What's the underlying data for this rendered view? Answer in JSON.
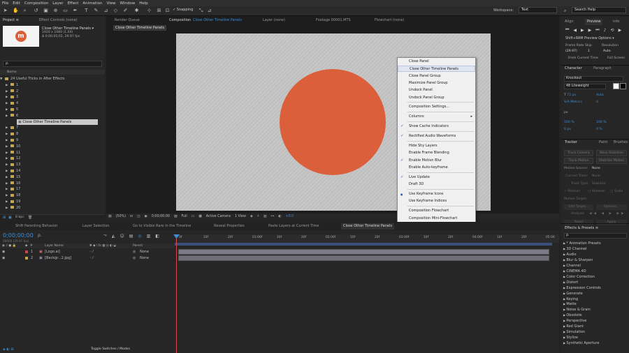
{
  "menu": [
    "File",
    "Edit",
    "Composition",
    "Layer",
    "Effect",
    "Animation",
    "View",
    "Window",
    "Help"
  ],
  "toolbar": {
    "snapping": "Snapping",
    "workspace_label": "Workspace:",
    "workspace_value": "Text",
    "search_help": "Search Help"
  },
  "project": {
    "tabs": [
      "Project ≡",
      "Effect Controls (none)"
    ],
    "selected_name": "Close Other Timeline Panels ▾",
    "selected_info1": "1920 x 1080 (1.00)",
    "selected_info2": "Δ 0;00;05;01, 29.97 fps",
    "search_placeholder": "ρ.",
    "col_name": "Name",
    "root": "24 Useful Tricks in After Effects",
    "folders": [
      "1",
      "2",
      "3",
      "4",
      "5",
      "6",
      "Close Other Timeline Panels",
      "7",
      "8",
      "9",
      "10",
      "11",
      "12",
      "13",
      "14",
      "15",
      "16",
      "17",
      "18",
      "19",
      "20"
    ],
    "bpc": "8 bpc"
  },
  "comp": {
    "tabs": [
      "Render Queue",
      "Composition",
      "Close Other Timeline Panels",
      "Layer (none)",
      "Footage 00001.MTS",
      "Flowchart (none)"
    ],
    "subtab": "Close Other Timeline Panels",
    "footer": {
      "zoom": "(50%)",
      "time": "0;00;00;00",
      "res": "Full",
      "camera": "Active Camera",
      "view": "1 View",
      "exposure": "+0.0"
    }
  },
  "context_menu": [
    {
      "label": "Close Panel",
      "checked": false
    },
    {
      "label": "Close Other Timeline Panels",
      "checked": false,
      "hover": true
    },
    {
      "label": "Close Panel Group",
      "checked": false
    },
    {
      "label": "Maximize Panel Group",
      "checked": false
    },
    {
      "label": "Undock Panel",
      "checked": false
    },
    {
      "label": "Undock Panel Group",
      "checked": false,
      "sep_after": true
    },
    {
      "label": "Composition Settings...",
      "checked": false,
      "sep_after": true
    },
    {
      "label": "Columns",
      "checked": false,
      "submenu": true,
      "sep_after": true
    },
    {
      "label": "Show Cache Indicators",
      "checked": true,
      "sep_after": true
    },
    {
      "label": "Rectified Audio Waveforms",
      "checked": true,
      "sep_after": true
    },
    {
      "label": "Hide Shy Layers",
      "checked": false
    },
    {
      "label": "Enable Frame Blending",
      "checked": false
    },
    {
      "label": "Enable Motion Blur",
      "checked": true
    },
    {
      "label": "Enable Auto-keyframe",
      "checked": false,
      "sep_after": true
    },
    {
      "label": "Live Update",
      "checked": true
    },
    {
      "label": "Draft 3D",
      "checked": false,
      "sep_after": true
    },
    {
      "label": "Use Keyframe Icons",
      "checked": "dot"
    },
    {
      "label": "Use Keyframe Indices",
      "checked": false,
      "sep_after": true
    },
    {
      "label": "Composition Flowchart",
      "checked": false
    },
    {
      "label": "Composition Mini-Flowchart",
      "checked": false
    }
  ],
  "right": {
    "tabs1": [
      "Align",
      "Preview",
      "Info"
    ],
    "preview_options": "Shift+RAM Preview Options ▾",
    "frame_rate": "Frame Rate",
    "skip": "Skip",
    "resolution": "Resolution",
    "fr_val": "(29.97)",
    "skip_val": "1",
    "res_val": "Auto",
    "from_current": "From Current Time",
    "full_screen": "Full Screen",
    "tabs2": [
      "Character",
      "Paragraph"
    ],
    "font": "Knockout",
    "style": "48 Liteweight",
    "size": "72 px",
    "leading": "Auto",
    "tracking": "0",
    "px": "px",
    "scale1": "100 %",
    "scale2": "100 %",
    "base": "0 px",
    "tsume": "0 %",
    "tabs3": [
      "Tracker",
      "Paint",
      "Brushes"
    ],
    "track_camera": "Track Camera",
    "warp": "Warp Stabilizer",
    "track_motion": "Track Motion",
    "stabilize": "Stabilize Motion",
    "motion_source": "Motion Source:",
    "none": "None",
    "current_track": "Current Track:",
    "track_type": "Track Type:",
    "stab": "Stabilize",
    "position": "Position",
    "rotation": "Rotation",
    "scale": "Scale",
    "motion_target": "Motion Target:",
    "edit_target": "Edit Target...",
    "options": "Options...",
    "analyze": "Analyze:",
    "reset": "Reset",
    "apply": "Apply",
    "fx_tab": "Effects & Presets ≡",
    "fx_search": "ρ.",
    "effects": [
      "* Animation Presets",
      "3D Channel",
      "Audio",
      "Blur & Sharpen",
      "Channel",
      "CINEMA 4D",
      "Color Correction",
      "Distort",
      "Expression Controls",
      "Generate",
      "Keying",
      "Matte",
      "Noise & Grain",
      "Obsolete",
      "Perspective",
      "Red Giant",
      "Simulation",
      "Stylize",
      "Synthetic Aperture"
    ]
  },
  "timeline": {
    "tabs": [
      "Shift Parenting Behavior",
      "Layer Selection",
      "Go to Visible Rare in the Timeline",
      "Reveal Properties",
      "Paste Layers at Current Time",
      "Close Other Timeline Panels"
    ],
    "timecode": "0;00;00;00",
    "fps": "00000 (29.97 fps)",
    "col_layer": "Layer Name",
    "col_parent": "Parent",
    "layers": [
      {
        "num": "1",
        "name": "[Logo.ai]",
        "parent": "None"
      },
      {
        "num": "2",
        "name": "[Backgr...2.jpg]",
        "parent": "None"
      }
    ],
    "ruler": [
      "0f",
      "10f",
      "20f",
      "01:00f",
      "10f",
      "20f",
      "02:00f",
      "10f",
      "20f",
      "03:00f",
      "10f",
      "20f",
      "04:00f",
      "10f",
      "20f",
      "05:00"
    ],
    "toggle": "Toggle Switches / Modes"
  },
  "colors": {
    "accent": "#3c8fd8",
    "circle": "#dc5f3b",
    "logo": "#dc5f3b",
    "playhead": "#e0454d"
  }
}
